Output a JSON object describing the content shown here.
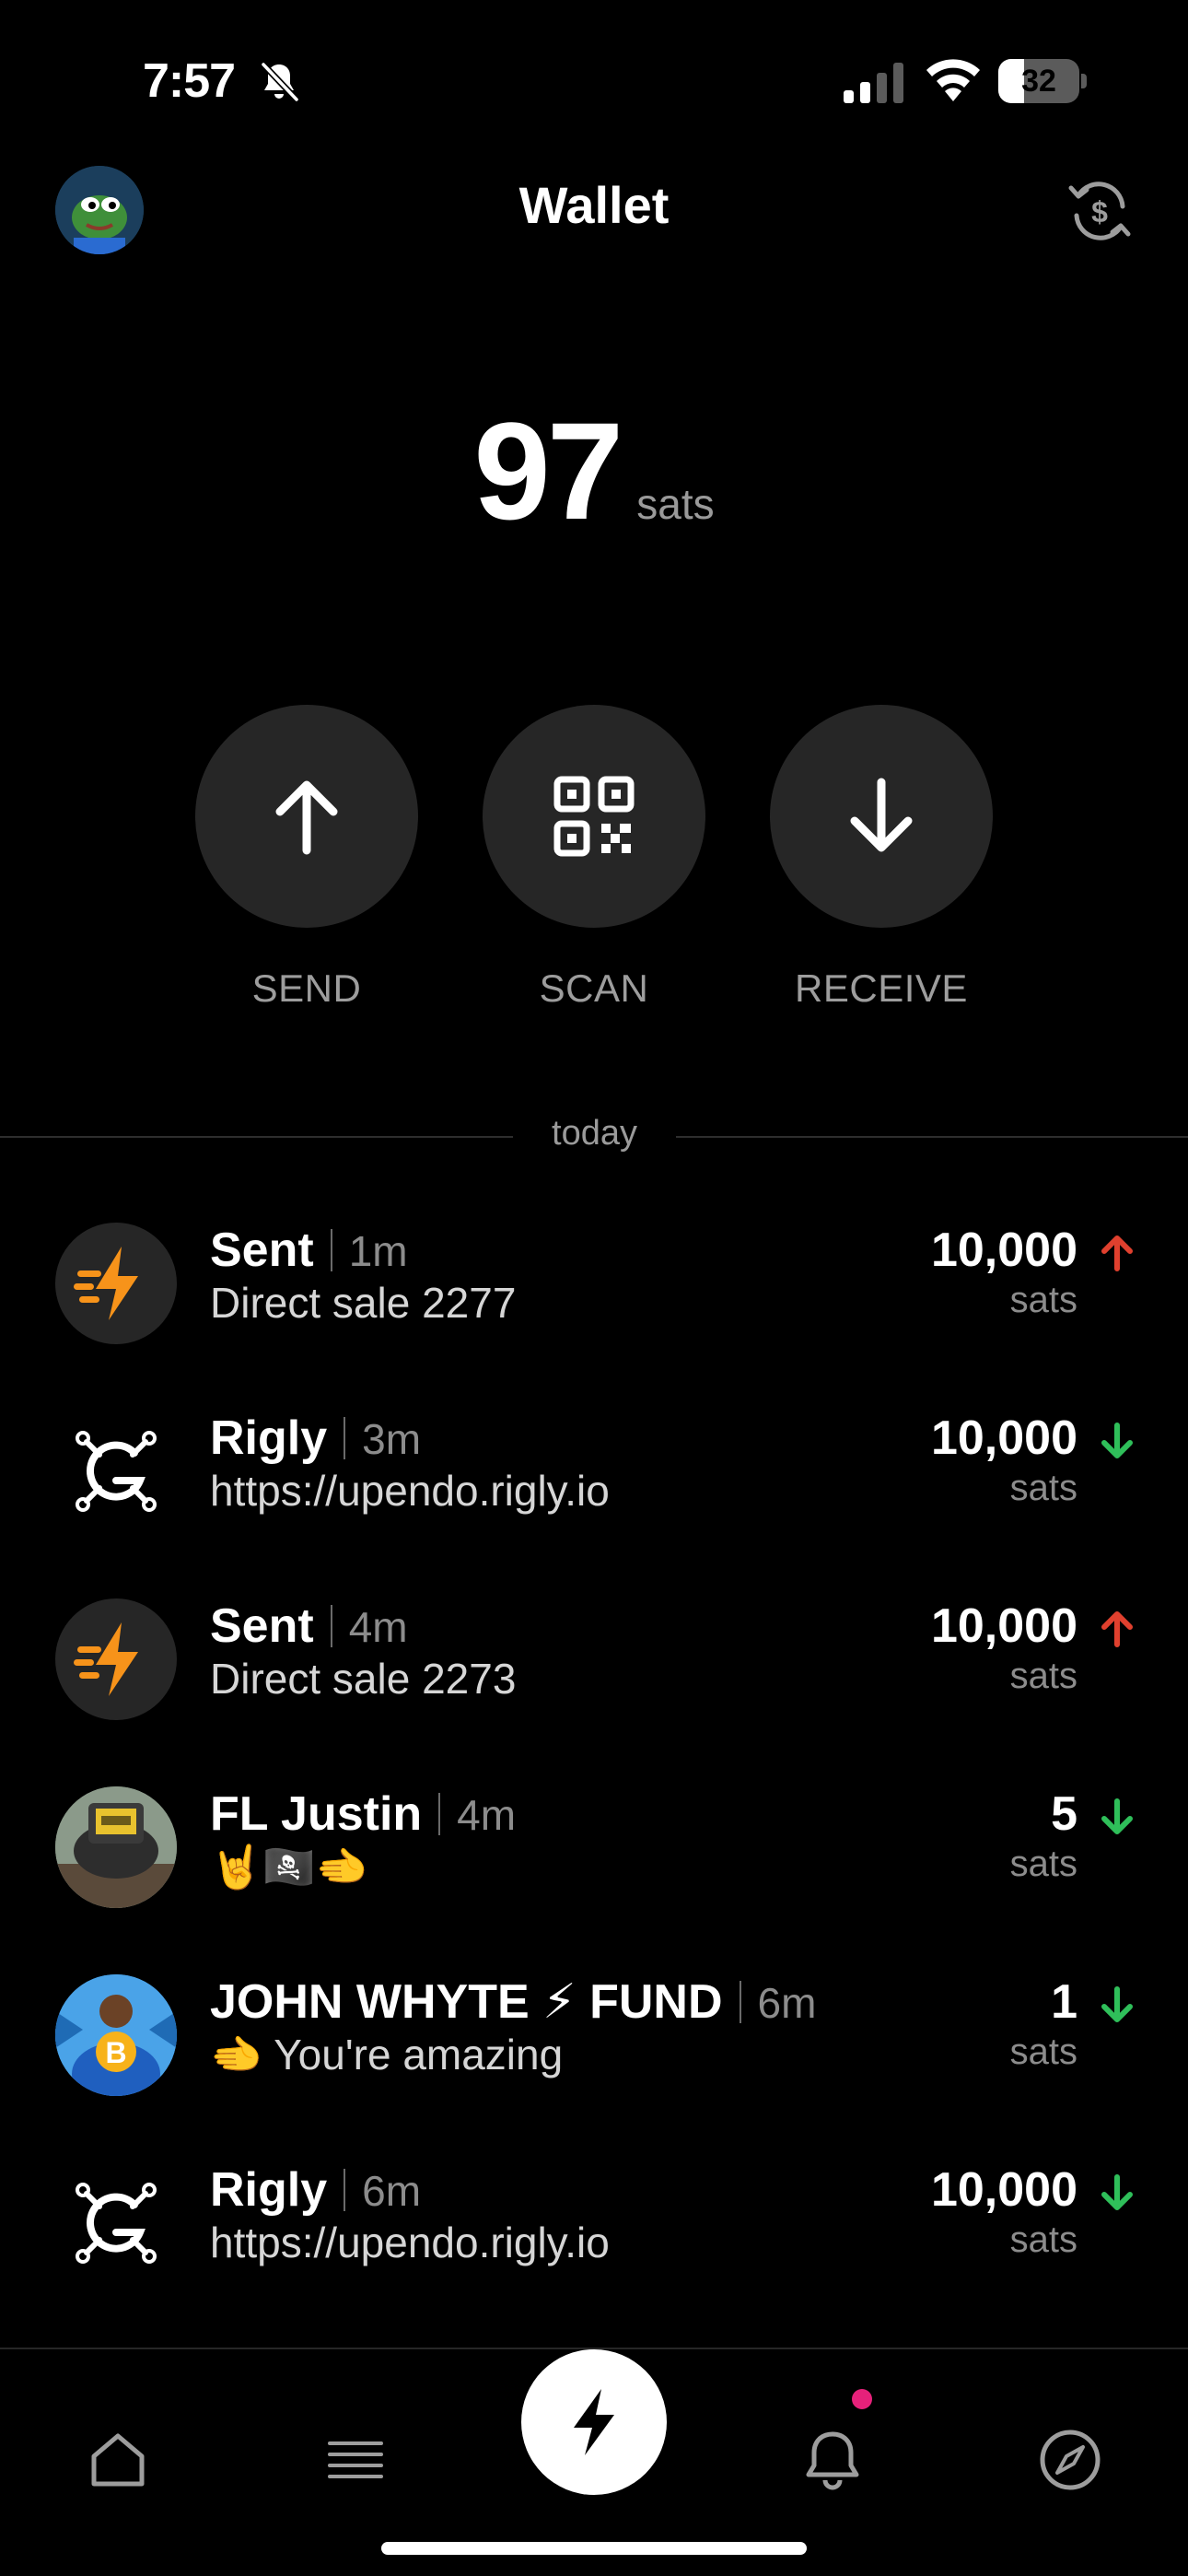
{
  "status_bar": {
    "time": "7:57",
    "battery": "32",
    "battery_level": 0.32,
    "icons": [
      "bell-slash-icon",
      "cellular-signal-icon",
      "wifi-icon",
      "battery-icon"
    ]
  },
  "header": {
    "title": "Wallet",
    "avatar": "profile-avatar",
    "right_icon": "currency-exchange-icon"
  },
  "balance": {
    "amount": "97",
    "unit": "sats"
  },
  "actions": [
    {
      "label": "SEND",
      "icon": "arrow-up-icon"
    },
    {
      "label": "SCAN",
      "icon": "qr-code-icon"
    },
    {
      "label": "RECEIVE",
      "icon": "arrow-down-icon"
    }
  ],
  "section_label": "today",
  "transactions": [
    {
      "name": "Sent",
      "ago": "1m",
      "desc": "Direct sale 2277",
      "amount": "10,000",
      "unit": "sats",
      "direction": "up",
      "icon": "lightning-icon"
    },
    {
      "name": "Rigly",
      "ago": "3m",
      "desc": "https://upendo.rigly.io",
      "amount": "10,000",
      "unit": "sats",
      "direction": "down",
      "icon": "rigly-logo-icon"
    },
    {
      "name": "Sent",
      "ago": "4m",
      "desc": "Direct sale 2273",
      "amount": "10,000",
      "unit": "sats",
      "direction": "up",
      "icon": "lightning-icon"
    },
    {
      "name": "FL Justin",
      "ago": "4m",
      "desc": "🤘🏴‍☠️🫲",
      "amount": "5",
      "unit": "sats",
      "direction": "down",
      "icon": "user-avatar"
    },
    {
      "name": "JOHN WHYTE ⚡ FUND",
      "ago": "6m",
      "desc": "🫲 You're amazing",
      "amount": "1",
      "unit": "sats",
      "direction": "down",
      "icon": "user-avatar"
    },
    {
      "name": "Rigly",
      "ago": "6m",
      "desc": "https://upendo.rigly.io",
      "amount": "10,000",
      "unit": "sats",
      "direction": "down",
      "icon": "rigly-logo-icon"
    }
  ],
  "tabs": [
    {
      "icon": "home-icon"
    },
    {
      "icon": "feed-icon"
    },
    {
      "icon": "lightning-icon"
    },
    {
      "icon": "bell-icon"
    },
    {
      "icon": "compass-icon"
    }
  ],
  "colors": {
    "background": "#000000",
    "button_bg": "#262626",
    "sent_accent": "#f7931a",
    "arrow_up": "#e0402e",
    "arrow_down": "#2fbf5a",
    "notification_dot": "#e6217a"
  }
}
